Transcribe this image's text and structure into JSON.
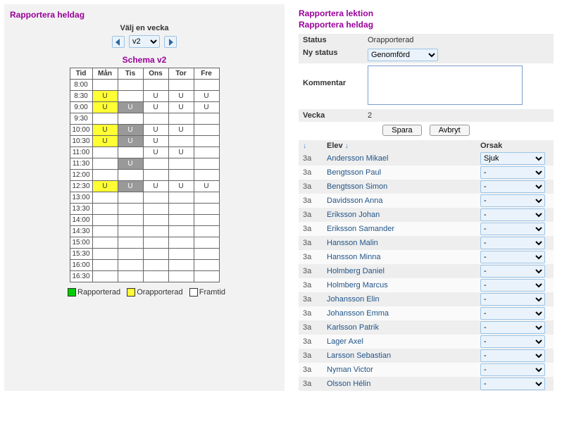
{
  "left": {
    "title": "Rapportera heldag",
    "week_label": "Välj en vecka",
    "week_value": "v2",
    "schema_title": "Schema v2",
    "columns": [
      "Tid",
      "Mån",
      "Tis",
      "Ons",
      "Tor",
      "Fre"
    ],
    "times": [
      "8:00",
      "8:30",
      "9:00",
      "9:30",
      "10:00",
      "10:30",
      "11:00",
      "11:30",
      "12:00",
      "12:30",
      "13:00",
      "13:30",
      "14:00",
      "14:30",
      "15:00",
      "15:30",
      "16:00",
      "16:30"
    ],
    "legend": {
      "reported": "Rapporterad",
      "unreported": "Orapporterad",
      "future": "Framtid"
    }
  },
  "right": {
    "title1": "Rapportera lektion",
    "title2": "Rapportera heldag",
    "status_label": "Status",
    "status_value": "Orapporterad",
    "new_status_label": "Ny status",
    "new_status_value": "Genomförd",
    "comment_label": "Kommentar",
    "comment_value": "",
    "week_label": "Vecka",
    "week_value": "2",
    "save_label": "Spara",
    "cancel_label": "Avbryt",
    "col_class_arrow": "↓",
    "col_student": "Elev",
    "col_student_arrow": "↓",
    "col_cause": "Orsak",
    "class_code": "3a",
    "default_cause": "-",
    "students": [
      {
        "name": "Andersson Mikael",
        "cause": "Sjuk"
      },
      {
        "name": "Bengtsson Paul",
        "cause": "-"
      },
      {
        "name": "Bengtsson Simon",
        "cause": "-"
      },
      {
        "name": "Davidsson Anna",
        "cause": "-"
      },
      {
        "name": "Eriksson Johan",
        "cause": "-"
      },
      {
        "name": "Eriksson Samander",
        "cause": "-"
      },
      {
        "name": "Hansson Malin",
        "cause": "-"
      },
      {
        "name": "Hansson Minna",
        "cause": "-"
      },
      {
        "name": "Holmberg Daniel",
        "cause": "-"
      },
      {
        "name": "Holmberg Marcus",
        "cause": "-"
      },
      {
        "name": "Johansson Elin",
        "cause": "-"
      },
      {
        "name": "Johansson Emma",
        "cause": "-"
      },
      {
        "name": "Karlsson Patrik",
        "cause": "-"
      },
      {
        "name": "Lager Axel",
        "cause": "-"
      },
      {
        "name": "Larsson Sebastian",
        "cause": "-"
      },
      {
        "name": "Nyman Victor",
        "cause": "-"
      },
      {
        "name": "Olsson Hélin",
        "cause": "-"
      }
    ]
  }
}
